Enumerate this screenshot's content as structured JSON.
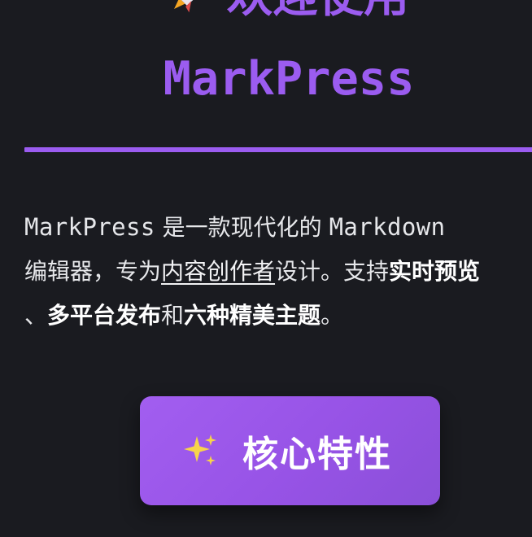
{
  "header": {
    "icon": "rocket-icon",
    "title_line1": "欢迎使用",
    "title_line2": "MarkPress",
    "accent_color": "#9b5cf0"
  },
  "intro": {
    "app_name": "MarkPress",
    "text_1": " 是一款现代化的 ",
    "markdown": "Markdown",
    "text_2": "编辑器，专为",
    "link_text": "内容创作者",
    "text_3": "设计。支持",
    "bold_1": "实时预览",
    "text_4": "、",
    "bold_2": "多平台发布",
    "text_5": "和",
    "bold_3": "六种精美主题",
    "text_6": "。"
  },
  "feature_button": {
    "icon": "sparkles-icon",
    "label": "核心特性"
  }
}
